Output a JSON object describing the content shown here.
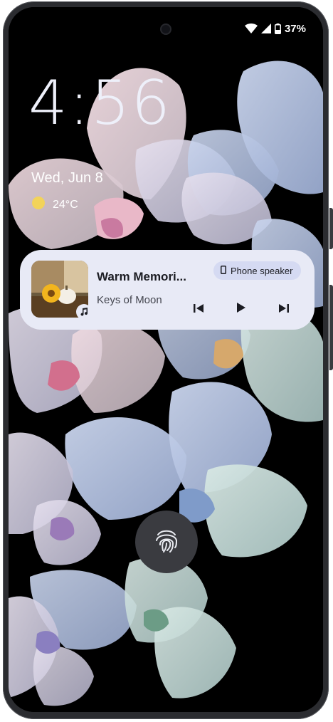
{
  "status_bar": {
    "wifi_icon": "wifi-icon",
    "signal_icon": "cell-signal-icon",
    "battery_icon": "battery-icon",
    "battery_percent": "37%"
  },
  "lockscreen": {
    "time": "4:56",
    "date": "Wed, Jun 8",
    "weather": {
      "icon": "sun-icon",
      "temperature": "24°C"
    }
  },
  "media_player": {
    "title": "Warm Memori...",
    "artist": "Keys of Moon",
    "output_device": "Phone speaker",
    "app_badge_icon": "music-note-icon",
    "controls": {
      "previous_icon": "skip-previous-icon",
      "play_icon": "play-icon",
      "next_icon": "skip-next-icon"
    }
  },
  "fingerprint": {
    "icon": "fingerprint-icon"
  },
  "colors": {
    "card_background": "#e8eaf6",
    "chip_background": "#d5daf2",
    "clock_color": "#eef0fa",
    "sun_color": "#f2d35a"
  }
}
